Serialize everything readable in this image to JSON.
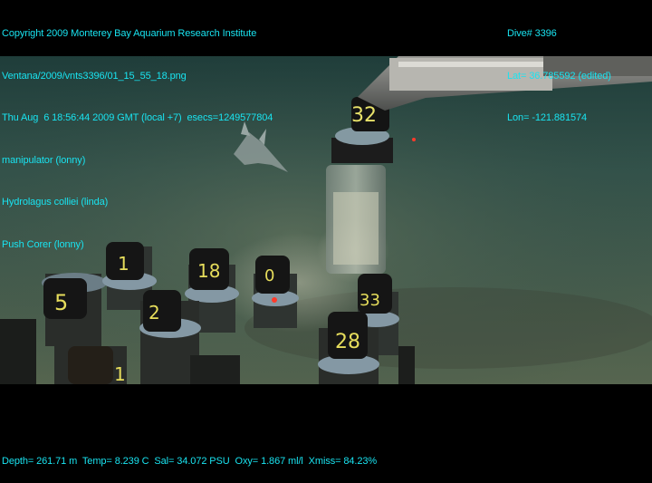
{
  "overlay_left": [
    "Copyright 2009 Monterey Bay Aquarium Research Institute",
    "Ventana/2009/vnts3396/01_15_55_18.png",
    "Thu Aug  6 18:56:44 2009 GMT (local +7)  esecs=1249577804",
    "manipulator (lonny)",
    "Hydrolagus colliei (linda)",
    "Push Corer (lonny)"
  ],
  "overlay_right": [
    "Dive# 3396",
    "Lat= 36.785592 (edited)",
    "Lon= -121.881574"
  ],
  "overlay_bottom": "Depth= 261.71 m  Temp= 8.239 C  Sal= 34.072 PSU  Oxy= 1.867 ml/l  Xmiss= 84.23%",
  "core_labels": [
    "32",
    "5",
    "1",
    "18",
    "0",
    "33",
    "2",
    "28",
    "1"
  ],
  "colors": {
    "overlay_text": "#19e3f0",
    "seafloor_top": "#294a44",
    "seafloor_bottom": "#55664f"
  }
}
